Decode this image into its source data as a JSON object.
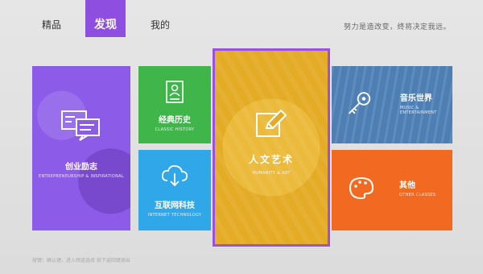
{
  "nav": {
    "tabs": [
      {
        "label": "精品"
      },
      {
        "label": "发现"
      },
      {
        "label": "我的"
      }
    ],
    "slogan": "努力是造改变，终将决定我远。"
  },
  "tiles": {
    "startup": {
      "title": "创业励志",
      "sub": "ENTREPRENEURSHIP & INSPIRATIONAL",
      "icon": "message-icon"
    },
    "history": {
      "title": "经典历史",
      "sub": "CLASSIC HISTORY",
      "icon": "person-card-icon"
    },
    "cloud": {
      "title": "互联网科技",
      "sub": "INTERNET TECHNOLOGY",
      "icon": "cloud-download-icon"
    },
    "arts": {
      "title": "人文艺术",
      "sub": "HUMANITY & ART",
      "icon": "pencil-edit-icon"
    },
    "music": {
      "title": "音乐世界",
      "sub": "MUSIC & ENTERTAINMENT",
      "icon": "key-icon"
    },
    "other": {
      "title": "其他",
      "sub": "OTHER CLASSES",
      "icon": "palette-icon"
    }
  },
  "footer": {
    "text": "按键：确认键，进入频道选择 按下返回键退出"
  },
  "colors": {
    "accent": "#8e4fe0",
    "startup": "#8c5be8",
    "history": "#3fb54a",
    "cloud": "#30a7e8",
    "arts": "#e4ac25",
    "music": "#4d7fb4",
    "other": "#f26a22"
  }
}
